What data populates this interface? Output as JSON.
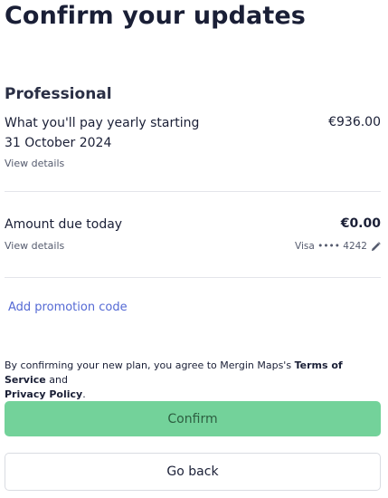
{
  "page": {
    "title": "Confirm your updates"
  },
  "plan": {
    "name": "Professional",
    "yearly_label_line1": "What you'll pay yearly starting",
    "yearly_label_line2": "31 October 2024",
    "yearly_price": "€936.00",
    "view_details_1": "View details"
  },
  "due": {
    "label": "Amount due today",
    "amount": "€0.00",
    "view_details_2": "View details",
    "payment_method": "Visa •••• 4242"
  },
  "promo": {
    "label": "Add promotion code"
  },
  "terms": {
    "prefix": "By confirming your new plan, you agree to Mergin Maps's ",
    "terms_link": "Terms of Service",
    "and": " and",
    "privacy_link": "Privacy Policy",
    "suffix": "."
  },
  "actions": {
    "confirm_label": "Confirm",
    "back_label": "Go back"
  },
  "colors": {
    "accent_green": "#73d29a",
    "link_blue": "#5469d4",
    "text_dark": "#1a1f36"
  }
}
